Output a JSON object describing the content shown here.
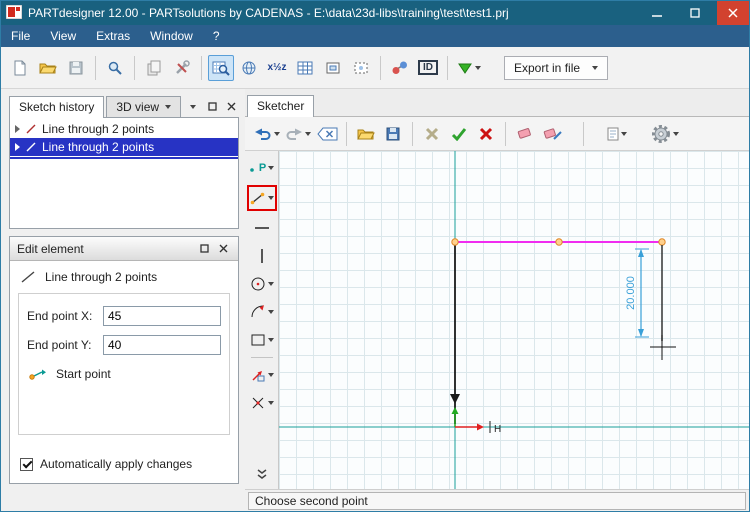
{
  "window": {
    "title": "PARTdesigner 12.00 - PARTsolutions by CADENAS - E:\\data\\23d-libs\\training\\test\\test1.prj"
  },
  "menu": {
    "items": [
      "File",
      "View",
      "Extras",
      "Window",
      "?"
    ]
  },
  "toolbar": {
    "export_label": "Export in file",
    "id_label": "ID",
    "vars_label": "x½z"
  },
  "sketch_history": {
    "tabs": {
      "active": "Sketch history",
      "other": "3D view"
    },
    "items": [
      {
        "label": "Line through 2 points"
      },
      {
        "label": "Line through 2 points"
      }
    ]
  },
  "edit_element": {
    "title": "Edit element",
    "element_type": "Line through 2 points",
    "fields": [
      {
        "label": "End point X:",
        "value": "45"
      },
      {
        "label": "End point Y:",
        "value": "40"
      }
    ],
    "start_point_label": "Start point",
    "checkbox_label": "Automatically apply changes"
  },
  "sketcher": {
    "tab": "Sketcher"
  },
  "canvas": {
    "dimension_label": "20.000",
    "h_label": "H"
  },
  "tools": {
    "point_label": "P"
  },
  "statusbar": {
    "text": "Choose second point"
  }
}
